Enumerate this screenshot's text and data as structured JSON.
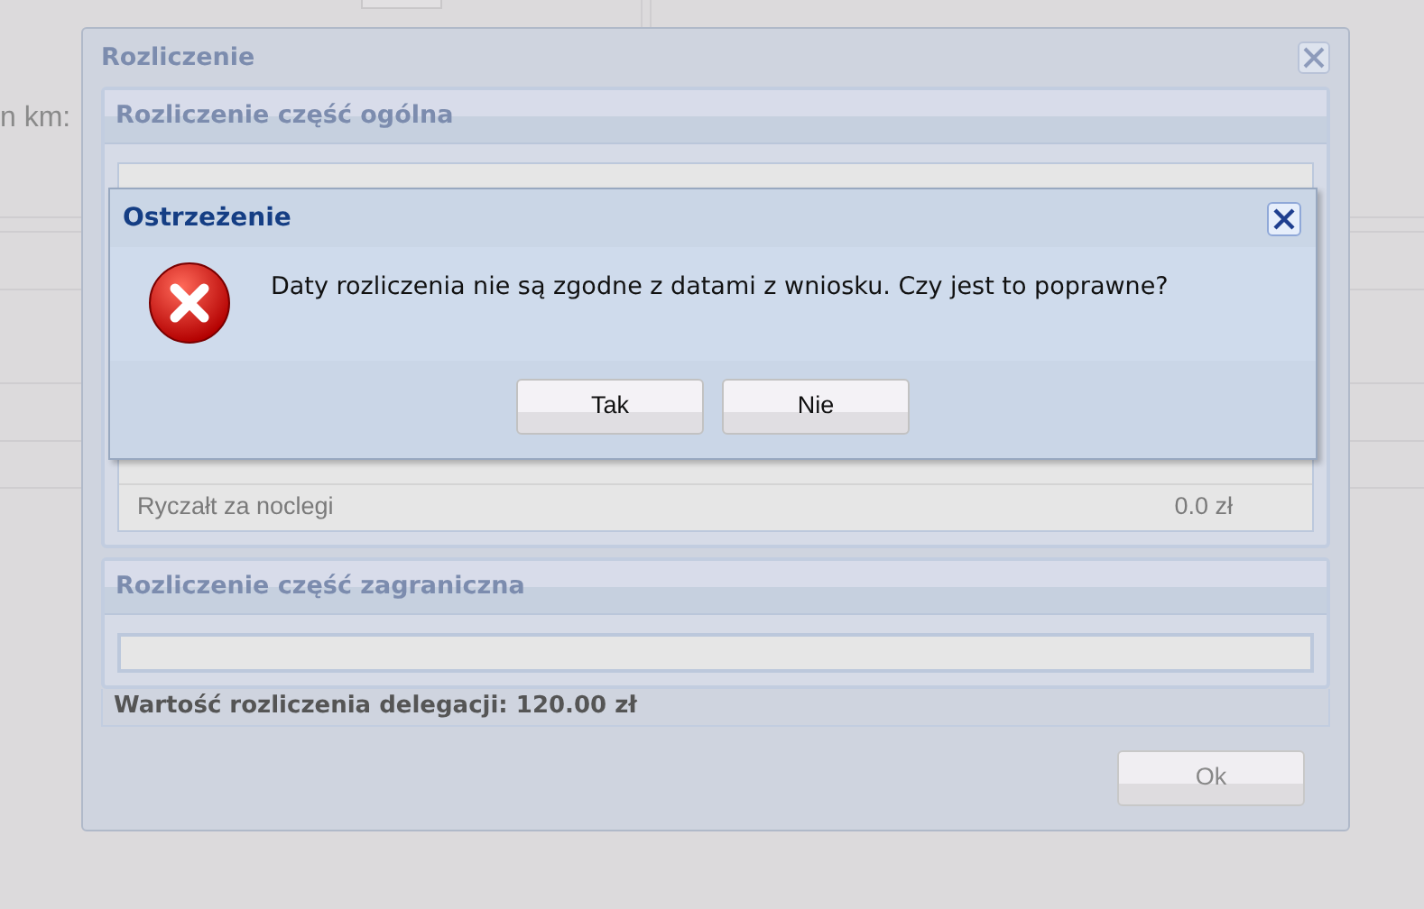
{
  "background": {
    "field_label": "n km:"
  },
  "window": {
    "title": "Rozliczenie",
    "sections": [
      {
        "title": "Rozliczenie część ogólna",
        "rows": [
          {
            "label": "Ryczałt za noclegi",
            "amount": "0.0 zł"
          }
        ]
      },
      {
        "title": "Rozliczenie część zagraniczna"
      }
    ],
    "total": "Wartość rozliczenia delegacji: 120.00 zł",
    "buttons": [
      "Ok"
    ]
  },
  "dialog": {
    "title": "Ostrzeżenie",
    "message": "Daty rozliczenia nie są zgodne z datami z wniosku. Czy jest to poprawne?",
    "buttons": [
      "Tak",
      "Nie"
    ]
  }
}
